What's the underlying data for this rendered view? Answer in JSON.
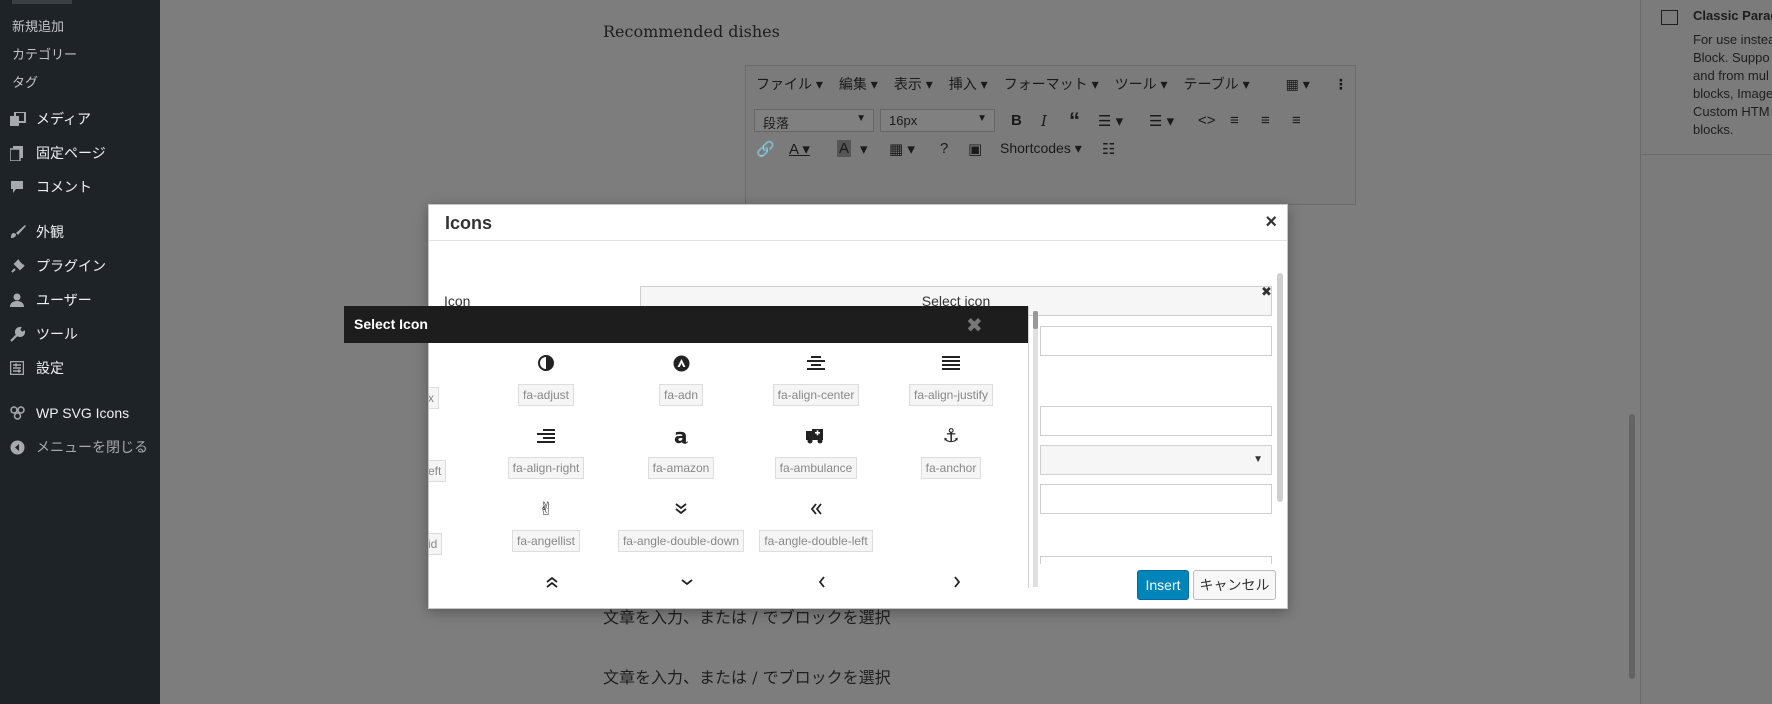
{
  "sidebar": {
    "submenu": [
      "新規追加",
      "カテゴリー",
      "タグ"
    ],
    "items": [
      {
        "label": "メディア",
        "icon": "media-icon"
      },
      {
        "label": "固定ページ",
        "icon": "page-icon"
      },
      {
        "label": "コメント",
        "icon": "comment-icon"
      },
      {
        "label": "外観",
        "icon": "appearance-icon"
      },
      {
        "label": "プラグイン",
        "icon": "plugin-icon"
      },
      {
        "label": "ユーザー",
        "icon": "user-icon"
      },
      {
        "label": "ツール",
        "icon": "wrench-icon"
      },
      {
        "label": "設定",
        "icon": "settings-icon"
      },
      {
        "label": "WP SVG Icons",
        "icon": "svg-icons-icon"
      },
      {
        "label": "メニューを閉じる",
        "icon": "collapse-icon"
      }
    ]
  },
  "editor": {
    "heading": "Recommended dishes",
    "placeholder_1": "文章を入力、または / でブロックを選択",
    "placeholder_2": "文章を入力、または / でブロックを選択",
    "menubar": [
      "ファイル",
      "編集",
      "表示",
      "挿入",
      "フォーマット",
      "ツール",
      "テーブル"
    ],
    "block_format": "段落",
    "font_size": "16px",
    "shortcodes": "Shortcodes"
  },
  "right_panel": {
    "title": "Classic Parag",
    "description": "For use instea\nBlock. Suppo\nand from mul\nblocks, Image\nCustom HTM\nblocks."
  },
  "modal": {
    "title": "Icons",
    "icon_label": "Icon",
    "select_icon_button": "Select icon",
    "insert_button": "Insert",
    "cancel_button": "キャンセル"
  },
  "icon_picker": {
    "title": "Select Icon",
    "cut_labels": [
      "x",
      "eft",
      "id"
    ],
    "icons": [
      {
        "name": "fa-adjust",
        "glyph": "◑"
      },
      {
        "name": "fa-adn",
        "glyph": "adn"
      },
      {
        "name": "fa-align-center",
        "glyph": "align-center"
      },
      {
        "name": "fa-align-justify",
        "glyph": "align-justify"
      },
      {
        "name": "fa-align-right",
        "glyph": "align-right"
      },
      {
        "name": "fa-amazon",
        "glyph": "a"
      },
      {
        "name": "fa-ambulance",
        "glyph": "ambulance"
      },
      {
        "name": "fa-anchor",
        "glyph": "⚓"
      },
      {
        "name": "fa-angellist",
        "glyph": "✌"
      },
      {
        "name": "fa-angle-double-down",
        "glyph": "double-down"
      },
      {
        "name": "fa-angle-double-left",
        "glyph": "«"
      }
    ]
  }
}
